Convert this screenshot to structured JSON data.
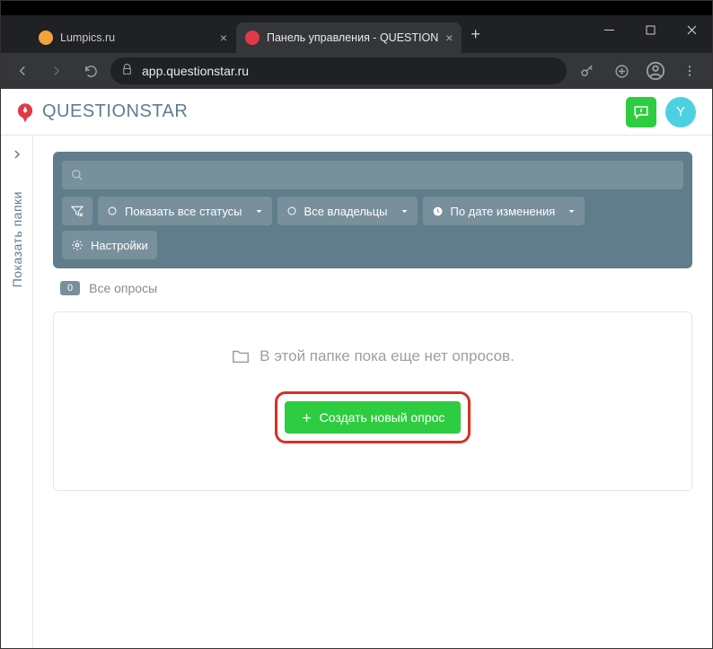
{
  "browser": {
    "tabs": [
      {
        "title": "Lumpics.ru",
        "favicon_color": "#f2a33c",
        "active": false
      },
      {
        "title": "Панель управления - QUESTION",
        "favicon_color": "#e03a4a",
        "active": true
      }
    ],
    "url": "app.questionstar.ru"
  },
  "app": {
    "brand": "QUESTIONSTAR",
    "avatar_letter": "Y"
  },
  "side_rail": {
    "label": "Показать  папки"
  },
  "filters": {
    "search_placeholder": "",
    "status": "Показать все статусы",
    "owners": "Все владельцы",
    "sort": "По дате изменения",
    "settings": "Настройки"
  },
  "listing": {
    "count": "0",
    "folder_name": "Все опросы",
    "empty_text": "В этой папке пока еще нет опросов.",
    "create_label": "Создать новый опрос"
  }
}
